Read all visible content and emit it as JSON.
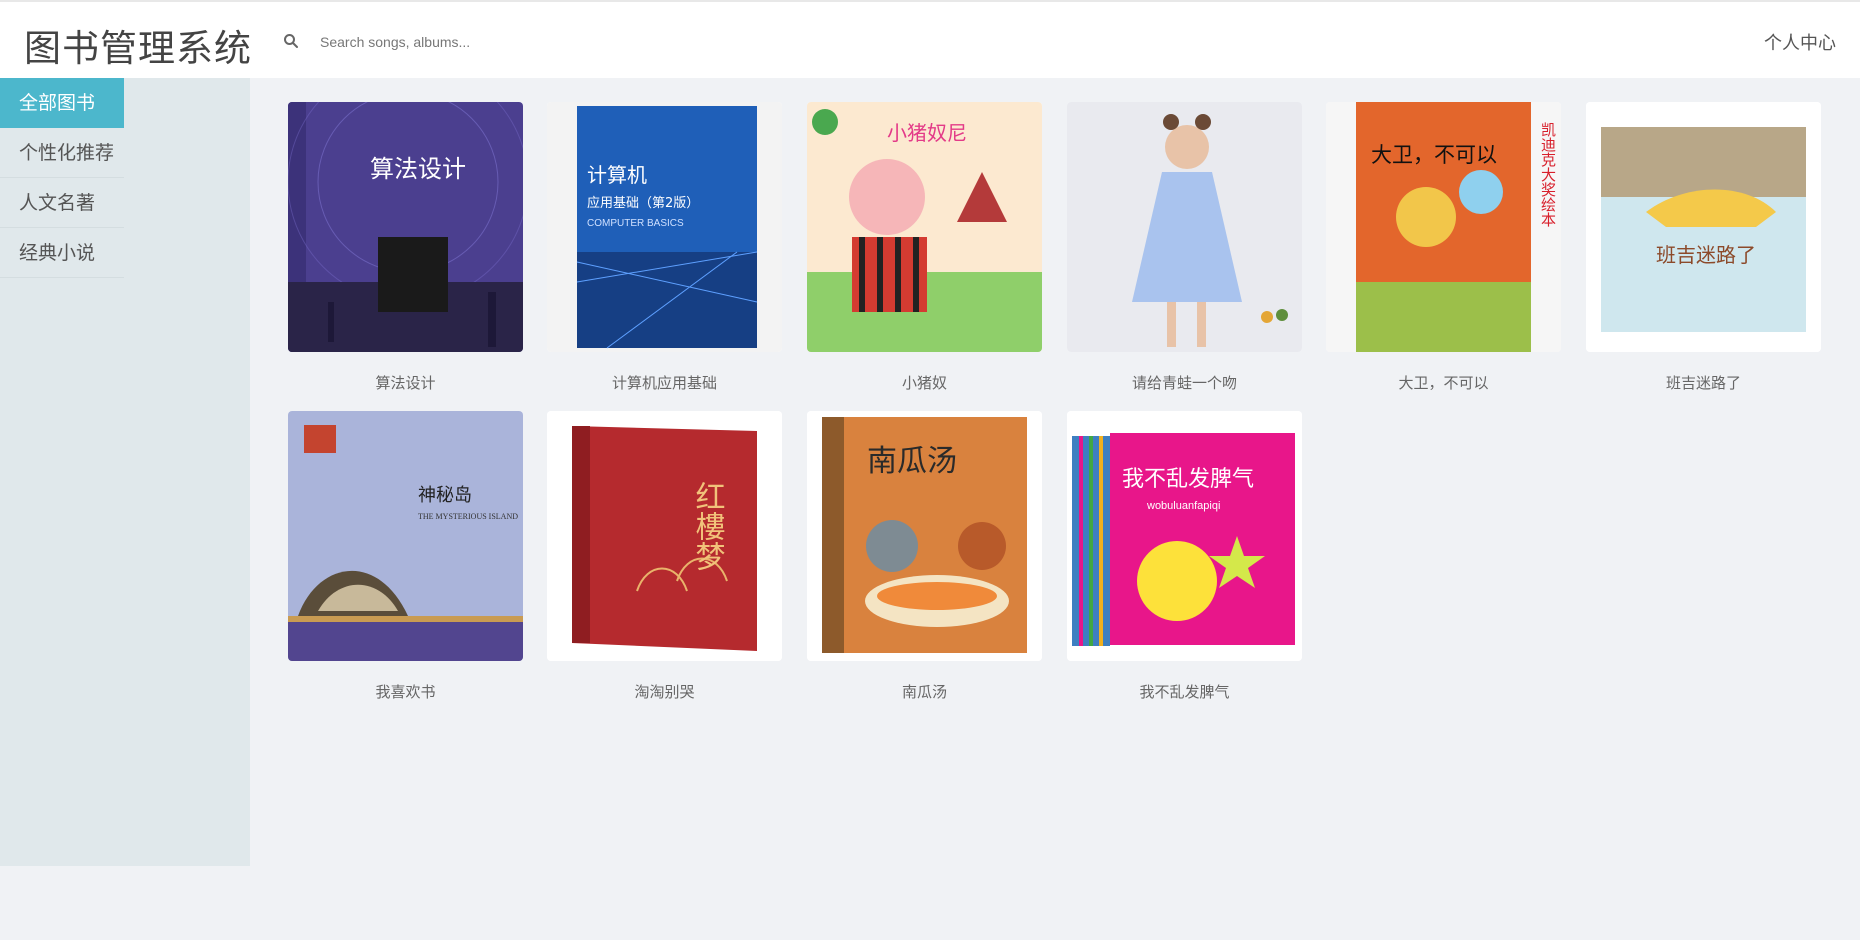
{
  "header": {
    "brand": "图书管理系统",
    "search_placeholder": "Search songs, albums...",
    "user_center": "个人中心"
  },
  "sidebar": {
    "items": [
      {
        "label": "全部图书",
        "active": true
      },
      {
        "label": "个性化推荐",
        "active": false
      },
      {
        "label": "人文名著",
        "active": false
      },
      {
        "label": "经典小说",
        "active": false
      }
    ]
  },
  "books": [
    {
      "title": "算法设计",
      "cover_text": "算法设计",
      "cover_sub": "",
      "bg": "#4b3f8f"
    },
    {
      "title": "计算机应用基础",
      "cover_text": "计算机",
      "cover_sub": "应用基础（第2版）",
      "bg": "#1f5fb8"
    },
    {
      "title": "小猪奴",
      "cover_text": "小猪奴尼",
      "cover_sub": "",
      "bg": "#fce9d0"
    },
    {
      "title": "请给青蛙一个吻",
      "cover_text": "",
      "cover_sub": "",
      "bg": "#e9eaef"
    },
    {
      "title": "大卫，不可以",
      "cover_text": "大卫，不可以",
      "cover_sub": "凯迪克大奖绘本",
      "bg": "#e3662c"
    },
    {
      "title": "班吉迷路了",
      "cover_text": "班吉迷路了",
      "cover_sub": "",
      "bg": "#cfe7ee"
    },
    {
      "title": "我喜欢书",
      "cover_text": "神秘岛",
      "cover_sub": "THE MYSTERIOUS ISLAND",
      "bg": "#aab4da"
    },
    {
      "title": "淘淘别哭",
      "cover_text": "红樓梦",
      "cover_sub": "",
      "bg": "#b52a2e"
    },
    {
      "title": "南瓜汤",
      "cover_text": "南瓜汤",
      "cover_sub": "",
      "bg": "#d9823e"
    },
    {
      "title": "我不乱发脾气",
      "cover_text": "我不乱发脾气",
      "cover_sub": "wobuluanfapiqi",
      "bg": "#e8168a"
    }
  ],
  "icons": {
    "search": "search-icon"
  },
  "colors": {
    "accent": "#4cb7cc"
  }
}
